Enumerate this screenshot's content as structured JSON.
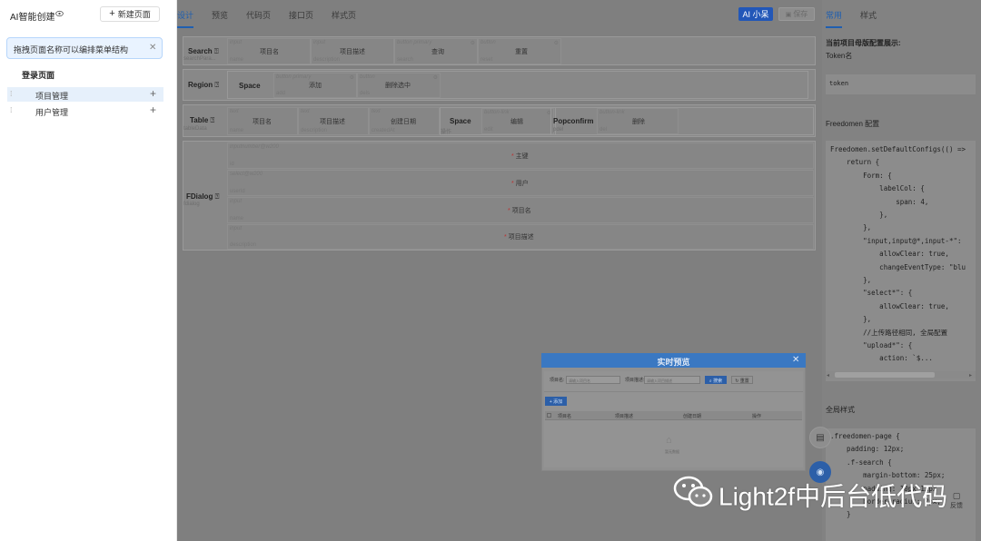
{
  "sidebar": {
    "title": "AI智能创建",
    "new_page_label": "新建页面",
    "tip_text": "拖拽页面名称可以编排菜单结构",
    "login_page": "登录页面",
    "items": [
      {
        "label": "项目管理"
      },
      {
        "label": "用户管理"
      }
    ]
  },
  "topnav": {
    "tabs": [
      {
        "label": "设计"
      },
      {
        "label": "预览"
      },
      {
        "label": "代码页"
      },
      {
        "label": "接口页"
      },
      {
        "label": "样式页"
      }
    ],
    "ai_label": "AI 小呆",
    "save_label": "保存"
  },
  "canvas": {
    "search": {
      "label": "Search",
      "sub": "searchPara...",
      "fields": [
        {
          "type": "input",
          "name": "name",
          "text": "项目名"
        },
        {
          "type": "input",
          "name": "description",
          "text": "项目描述"
        },
        {
          "type": "button primary",
          "name": "search",
          "text": "查询"
        },
        {
          "type": "button",
          "name": "reset",
          "text": "重置"
        }
      ]
    },
    "region": {
      "label": "Region",
      "space_label": "Space",
      "fields": [
        {
          "type": "button primary",
          "name": "add",
          "text": "添加"
        },
        {
          "type": "button",
          "name": "dels",
          "text": "删除选中"
        }
      ]
    },
    "table": {
      "label": "Table",
      "sub": "tableData",
      "columns": [
        {
          "type": "text",
          "name": "name",
          "text": "项目名"
        },
        {
          "type": "text",
          "name": "description",
          "text": "项目描述"
        },
        {
          "type": "text",
          "name": "createdAt",
          "text": "创建日期"
        }
      ],
      "space_label": "Space",
      "space_sub": "操作",
      "edit": {
        "type": "button-link",
        "name": "edit",
        "text": "编辑"
      },
      "popconfirm_label": "Popconfirm",
      "popconfirm_sub": "pdel",
      "del": {
        "type": "button-link",
        "name": "del",
        "text": "删除"
      }
    },
    "fdialog": {
      "label": "FDialog",
      "sub": "fdialog",
      "rows": [
        {
          "type": "inputnumber@w200",
          "name": "id",
          "text": "主键"
        },
        {
          "type": "select@w200",
          "name": "userId",
          "text": "用户"
        },
        {
          "type": "input",
          "name": "name",
          "text": "项目名"
        },
        {
          "type": "input",
          "name": "description",
          "text": "项目描述"
        }
      ]
    }
  },
  "right": {
    "tabs": [
      {
        "label": "常用"
      },
      {
        "label": "样式"
      }
    ],
    "config_title": "当前项目母版配置展示:",
    "token_label": "Token名",
    "token_value": "token",
    "freedomen_title": "Freedomen 配置",
    "code_lines": [
      "Freedomen.setDefaultConfigs(() =>",
      "    return {",
      "        Form: {",
      "            labelCol: {",
      "                span: 4,",
      "            },",
      "        },",
      "        \"input,input@*,input-*\":",
      "            allowClear: true,",
      "            changeEventType: \"blu",
      "        },",
      "        \"select*\": {",
      "            allowClear: true,",
      "        },",
      "        //上传路径相同, 全局配置",
      "        \"upload*\": {",
      "            action: `$..."
    ],
    "global_style_title": "全局样式",
    "style_lines": [
      ".freedomen-page {",
      "    padding: 12px;",
      "    .f-search {",
      "        margin-bottom: 25px;",
      "        padding: 10px 12px",
      "        border-radius: 2px;",
      "    }"
    ],
    "feedback_label": "反馈"
  },
  "preview": {
    "title": "实时预览",
    "field1_label": "项目名:",
    "field1_placeholder": "请输入项目名",
    "field2_label": "项目描述:",
    "field2_placeholder": "请输入项目描述",
    "search_btn": "搜索",
    "reset_btn": "重置",
    "add_btn": "添加",
    "columns": [
      "项目名",
      "项目描述",
      "创建日期",
      "操作"
    ],
    "empty_text": "暂无数据"
  },
  "watermark": "Light2f中后台低代码"
}
